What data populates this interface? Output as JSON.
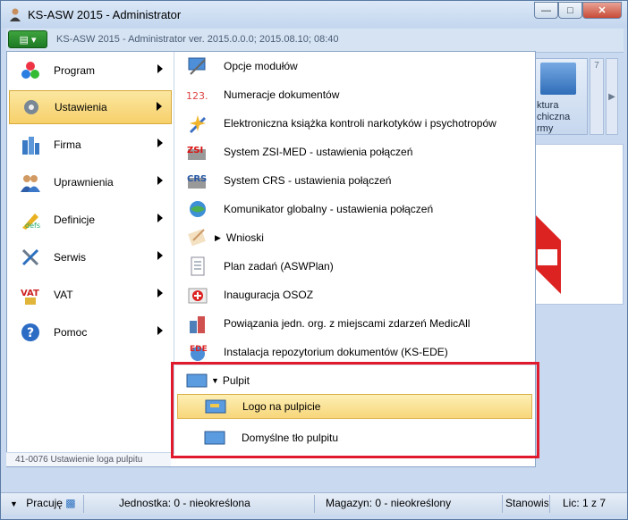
{
  "window": {
    "title": "KS-ASW 2015 - Administrator"
  },
  "ribbon": {
    "title": "KS-ASW 2015 - Administrator  ver. 2015.0.0.0;  2015.08.10; 08:40"
  },
  "left_menu": [
    {
      "label": "Program",
      "icon": "program-icon",
      "active": false
    },
    {
      "label": "Ustawienia",
      "icon": "settings-icon",
      "active": true
    },
    {
      "label": "Firma",
      "icon": "company-icon",
      "active": false
    },
    {
      "label": "Uprawnienia",
      "icon": "permissions-icon",
      "active": false
    },
    {
      "label": "Definicje",
      "icon": "definitions-icon",
      "active": false
    },
    {
      "label": "Serwis",
      "icon": "service-icon",
      "active": false
    },
    {
      "label": "VAT",
      "icon": "vat-icon",
      "active": false
    },
    {
      "label": "Pomoc",
      "icon": "help-icon",
      "active": false
    }
  ],
  "submenu": [
    {
      "label": "Opcje modułów",
      "icon": "modules-options-icon"
    },
    {
      "label": "Numeracje dokumentów",
      "icon": "numbering-icon"
    },
    {
      "label": "Elektroniczna książka kontroli narkotyków i psychotropów",
      "icon": "narcotics-book-icon"
    },
    {
      "label": "System ZSI-MED - ustawienia połączeń",
      "icon": "zsi-med-icon"
    },
    {
      "label": "System CRS - ustawienia połączeń",
      "icon": "crs-icon"
    },
    {
      "label": "Komunikator globalny - ustawienia połączeń",
      "icon": "global-communicator-icon"
    },
    {
      "label": "Wnioski",
      "icon": "requests-icon"
    },
    {
      "label": "Plan zadań (ASWPlan)",
      "icon": "task-plan-icon"
    },
    {
      "label": "Inauguracja OSOZ",
      "icon": "osoz-icon"
    },
    {
      "label": "Powiązania jedn. org. z miejscami zdarzeń MedicAll",
      "icon": "medicall-icon"
    },
    {
      "label": "Instalacja repozytorium dokumentów (KS-EDE)",
      "icon": "ede-icon"
    }
  ],
  "pulpit": {
    "label": "Pulpit",
    "items": [
      {
        "label": "Logo na pulpicie",
        "icon": "desktop-logo-icon"
      },
      {
        "label": "Domyślne tło pulpitu",
        "icon": "desktop-background-icon"
      }
    ]
  },
  "right_ribbon": {
    "button_label": "ktura\nchiczna\nrmy",
    "page_number": "7"
  },
  "status_hint": "41-0076  Ustawienie loga pulpitu",
  "statusbar": {
    "mode": "Pracuję",
    "unit": "Jednostka: 0 - nieokreślona",
    "warehouse": "Magazyn: 0 - nieokreślony",
    "station": "Stanowisko",
    "counter": "Lic: 1 z 7"
  },
  "colors": {
    "active_item": "#f7d06a",
    "highlight_border": "#e0192c",
    "app_button": "#1d7a24"
  }
}
